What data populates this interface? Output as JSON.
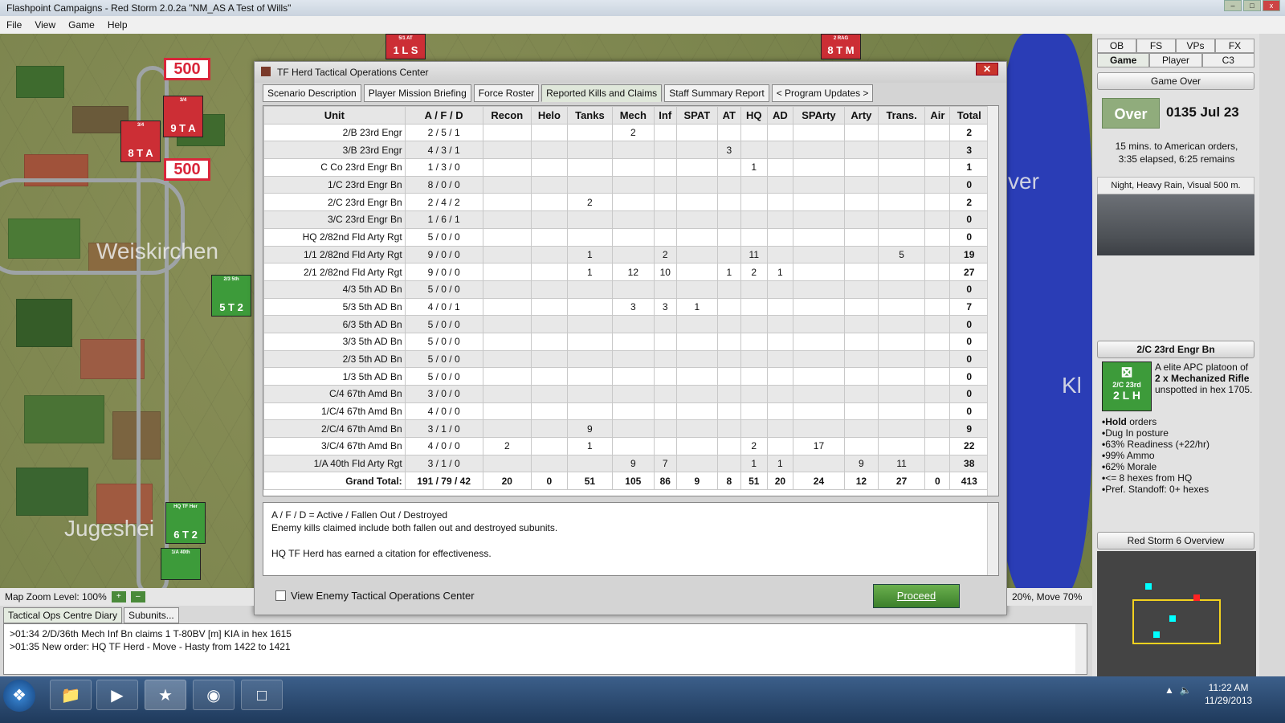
{
  "window": {
    "title": "Flashpoint Campaigns - Red Storm  2.0.2a  \"NM_AS A Test of Wills\""
  },
  "menu": [
    "File",
    "View",
    "Game",
    "Help"
  ],
  "map": {
    "labels": [
      "Weiskirchen",
      "Jugeshei",
      "ver",
      "Kl"
    ],
    "badges": [
      "500",
      "500"
    ],
    "counters": [
      {
        "name": "3/4",
        "value": "9 T A",
        "top_label": "3/4",
        "color": "red"
      },
      {
        "name": "8 T A",
        "value": "8 T A",
        "top_label": "3/4",
        "color": "red"
      },
      {
        "name": "2/3 5th",
        "value": "5 T 2",
        "top_label": "2/3 5th",
        "color": "green"
      },
      {
        "name": "HQ TF Her",
        "value": "6 T 2",
        "top_label": "HQ TF Her",
        "color": "green"
      },
      {
        "name": "1/A 40th",
        "value": "",
        "top_label": "1/A 40th",
        "color": "green"
      },
      {
        "name": "5/1 AT",
        "value": "1 L S",
        "top_label": "5/1 AT",
        "color": "red"
      },
      {
        "name": "2 RAG",
        "value": "8 T M",
        "top_label": "2 RAG",
        "color": "red"
      }
    ]
  },
  "dialog": {
    "title": "TF Herd Tactical Operations Center",
    "tabs": [
      "Scenario Description",
      "Player Mission Briefing",
      "Force Roster",
      "Reported Kills and Claims",
      "Staff Summary Report",
      "< Program Updates >"
    ],
    "active_tab": "Reported Kills and Claims",
    "table": {
      "columns": [
        "Unit",
        "A / F / D",
        "Recon",
        "Helo",
        "Tanks",
        "Mech",
        "Inf",
        "SPAT",
        "AT",
        "HQ",
        "AD",
        "SPArty",
        "Arty",
        "Trans.",
        "Air",
        "Total"
      ],
      "rows": [
        [
          "2/B 23rd Engr",
          "2 / 5 / 1",
          "",
          "",
          "",
          "2",
          "",
          "",
          "",
          "",
          "",
          "",
          "",
          "",
          "",
          "2"
        ],
        [
          "3/B 23rd Engr",
          "4 / 3 / 1",
          "",
          "",
          "",
          "",
          "",
          "",
          "3",
          "",
          "",
          "",
          "",
          "",
          "",
          "3"
        ],
        [
          "C Co 23rd Engr Bn",
          "1 / 3 / 0",
          "",
          "",
          "",
          "",
          "",
          "",
          "",
          "1",
          "",
          "",
          "",
          "",
          "",
          "1"
        ],
        [
          "1/C 23rd Engr Bn",
          "8 / 0 / 0",
          "",
          "",
          "",
          "",
          "",
          "",
          "",
          "",
          "",
          "",
          "",
          "",
          "",
          "0"
        ],
        [
          "2/C 23rd Engr Bn",
          "2 / 4 / 2",
          "",
          "",
          "2",
          "",
          "",
          "",
          "",
          "",
          "",
          "",
          "",
          "",
          "",
          "2"
        ],
        [
          "3/C 23rd Engr Bn",
          "1 / 6 / 1",
          "",
          "",
          "",
          "",
          "",
          "",
          "",
          "",
          "",
          "",
          "",
          "",
          "",
          "0"
        ],
        [
          "HQ 2/82nd Fld Arty Rgt",
          "5 / 0 / 0",
          "",
          "",
          "",
          "",
          "",
          "",
          "",
          "",
          "",
          "",
          "",
          "",
          "",
          "0"
        ],
        [
          "1/1 2/82nd Fld Arty Rgt",
          "9 / 0 / 0",
          "",
          "",
          "1",
          "",
          "2",
          "",
          "",
          "11",
          "",
          "",
          "",
          "5",
          "",
          "19"
        ],
        [
          "2/1 2/82nd Fld Arty Rgt",
          "9 / 0 / 0",
          "",
          "",
          "1",
          "12",
          "10",
          "",
          "1",
          "2",
          "1",
          "",
          "",
          "",
          "",
          "27"
        ],
        [
          "4/3 5th AD Bn",
          "5 / 0 / 0",
          "",
          "",
          "",
          "",
          "",
          "",
          "",
          "",
          "",
          "",
          "",
          "",
          "",
          "0"
        ],
        [
          "5/3 5th AD Bn",
          "4 / 0 / 1",
          "",
          "",
          "",
          "3",
          "3",
          "1",
          "",
          "",
          "",
          "",
          "",
          "",
          "",
          "7"
        ],
        [
          "6/3 5th AD Bn",
          "5 / 0 / 0",
          "",
          "",
          "",
          "",
          "",
          "",
          "",
          "",
          "",
          "",
          "",
          "",
          "",
          "0"
        ],
        [
          "3/3 5th AD Bn",
          "5 / 0 / 0",
          "",
          "",
          "",
          "",
          "",
          "",
          "",
          "",
          "",
          "",
          "",
          "",
          "",
          "0"
        ],
        [
          "2/3 5th AD Bn",
          "5 / 0 / 0",
          "",
          "",
          "",
          "",
          "",
          "",
          "",
          "",
          "",
          "",
          "",
          "",
          "",
          "0"
        ],
        [
          "1/3 5th AD Bn",
          "5 / 0 / 0",
          "",
          "",
          "",
          "",
          "",
          "",
          "",
          "",
          "",
          "",
          "",
          "",
          "",
          "0"
        ],
        [
          "C/4 67th Amd Bn",
          "3 / 0 / 0",
          "",
          "",
          "",
          "",
          "",
          "",
          "",
          "",
          "",
          "",
          "",
          "",
          "",
          "0"
        ],
        [
          "1/C/4 67th Amd Bn",
          "4 / 0 / 0",
          "",
          "",
          "",
          "",
          "",
          "",
          "",
          "",
          "",
          "",
          "",
          "",
          "",
          "0"
        ],
        [
          "2/C/4 67th Amd Bn",
          "3 / 1 / 0",
          "",
          "",
          "9",
          "",
          "",
          "",
          "",
          "",
          "",
          "",
          "",
          "",
          "",
          "9"
        ],
        [
          "3/C/4 67th Amd Bn",
          "4 / 0 / 0",
          "2",
          "",
          "1",
          "",
          "",
          "",
          "",
          "2",
          "",
          "17",
          "",
          "",
          "",
          "22"
        ],
        [
          "1/A 40th Fld Arty Rgt",
          "3 / 1 / 0",
          "",
          "",
          "",
          "9",
          "7",
          "",
          "",
          "1",
          "1",
          "",
          "9",
          "11",
          "",
          "38"
        ]
      ],
      "grand_total": [
        "Grand Total:",
        "191 / 79 / 42",
        "20",
        "0",
        "51",
        "105",
        "86",
        "9",
        "8",
        "51",
        "20",
        "24",
        "12",
        "27",
        "0",
        "413"
      ]
    },
    "notes": [
      "A / F / D = Active / Fallen Out / Destroyed",
      "Enemy kills claimed include both fallen out and destroyed subunits.",
      "",
      "HQ TF Herd has earned a citation for effectiveness."
    ],
    "view_enemy_label": "View Enemy Tactical Operations Center",
    "proceed_label": "Proceed"
  },
  "right_panel": {
    "tabs_row1": [
      "OB",
      "FS",
      "VPs",
      "FX"
    ],
    "tabs_row2": [
      "Game",
      "Player",
      "C3"
    ],
    "selected_tab": "Game",
    "game_state_header": "Game Over",
    "over_label": "Over",
    "datetime": "0135 Jul 23",
    "orders_line1": "15 mins. to American orders,",
    "orders_line2": "3:35 elapsed, 6:25 remains",
    "weather": "Night, Heavy Rain, Visual 500 m.",
    "unit_header": "2/C 23rd Engr Bn",
    "unit_counter_label": "2/C 23rd",
    "unit_counter_value": "2 L H",
    "unit_desc_pre": "A elite APC platoon of ",
    "unit_desc_bold": "2 x Mechanized Rifle",
    "unit_desc_post": " unspotted in hex 1705.",
    "unit_orders_bold": "Hold",
    "unit_orders_rest": " orders",
    "unit_status": [
      "Dug In posture",
      "63% Readiness (+22/hr)",
      "99% Ammo",
      "62% Morale",
      "<= 8 hexes from HQ",
      "Pref. Standoff: 0+ hexes"
    ],
    "overview_header": "Red Storm 6 Overview"
  },
  "bottom": {
    "map_zoom": "Map Zoom Level: 100%",
    "move_stat": "20%, Move 70%",
    "tabs": [
      "Tactical Ops Centre Diary",
      "Subunits..."
    ],
    "log": [
      ">01:34  2/D/36th Mech Inf Bn claims 1 T-80BV [m] KIA in hex 1615",
      ">01:35  New order: HQ TF Herd - Move - Hasty from 1422 to 1421"
    ]
  },
  "taskbar": {
    "time": "11:22 AM",
    "date": "11/29/2013"
  }
}
